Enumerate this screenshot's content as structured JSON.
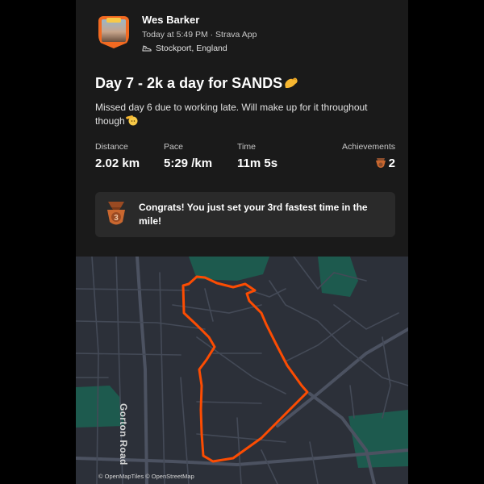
{
  "activity": {
    "athlete_name": "Wes Barker",
    "meta": "Today at 5:49 PM · Strava App",
    "location": "Stockport, England",
    "title": "Day 7 - 2k a day for SANDS",
    "description": "Missed day 6 due to working late. Will make up for it throughout though"
  },
  "stats": [
    {
      "label": "Distance",
      "value": "2.02 km"
    },
    {
      "label": "Pace",
      "value": "5:29 /km"
    },
    {
      "label": "Time",
      "value": "11m 5s"
    }
  ],
  "achievements": {
    "label": "Achievements",
    "count": "2"
  },
  "congrats": {
    "text": "Congrats! You just set your 3rd fastest time in the mile!",
    "medal_number": "3"
  },
  "map": {
    "road_label": "Gorton Road",
    "attribution": "© OpenMapTiles © OpenStreetMap",
    "route_color": "#fc4c02",
    "park_color": "#1d5a4e"
  },
  "colors": {
    "background": "#1a1a1a",
    "accent": "#f26a21",
    "card": "#2a2a2a"
  },
  "icons": {
    "shoe": "shoe-icon",
    "muscle": "flexed-biceps-emoji",
    "salute": "saluting-face-emoji",
    "medal": "medal-icon"
  }
}
